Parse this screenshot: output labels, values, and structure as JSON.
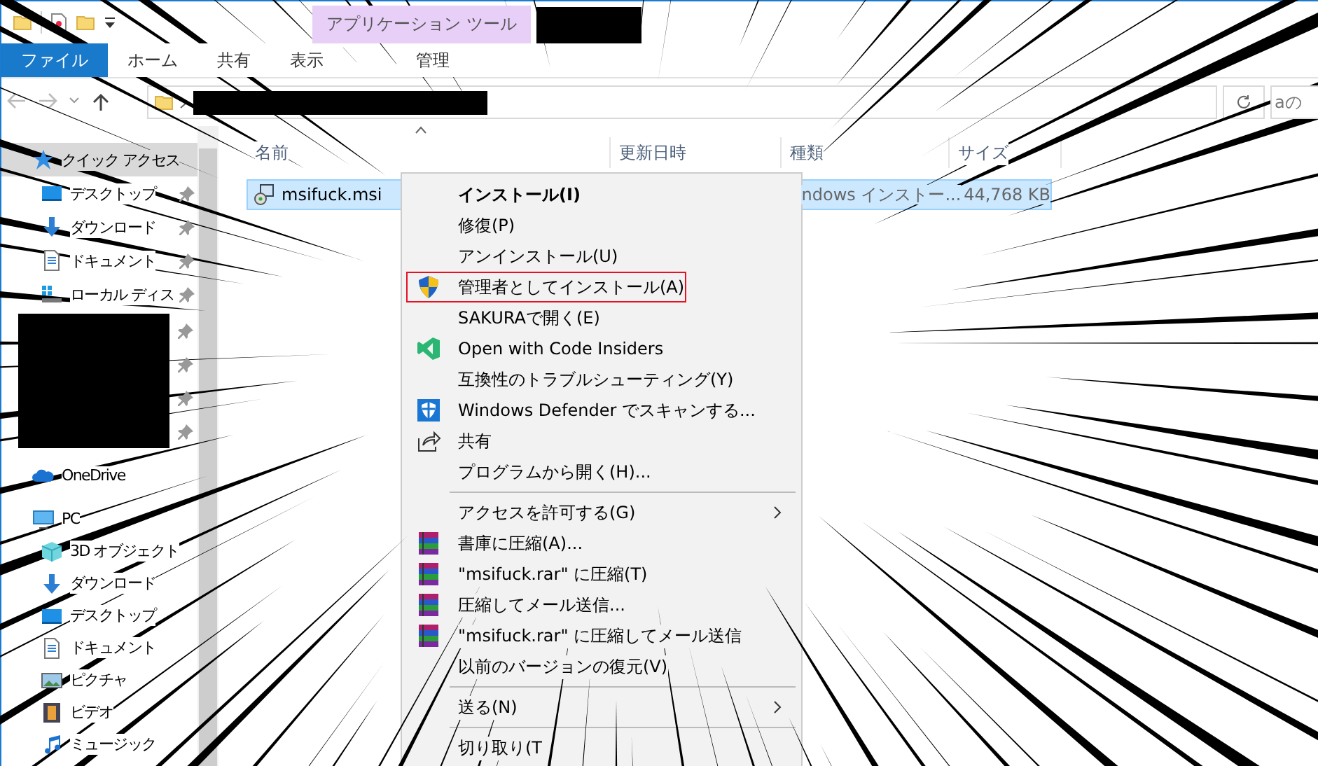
{
  "title_bar": {
    "contextual_tab": "アプリケーション ツール"
  },
  "ribbon_tabs": [
    {
      "label": "ファイル",
      "selected": true
    },
    {
      "label": "ホーム",
      "selected": false
    },
    {
      "label": "共有",
      "selected": false
    },
    {
      "label": "表示",
      "selected": false
    },
    {
      "label": "管理",
      "selected": false
    }
  ],
  "search": {
    "placeholder": "aの"
  },
  "sidebar": {
    "items": [
      {
        "label": "クイック アクセス",
        "kind": "star",
        "selected": true,
        "children": [
          {
            "label": "デスクトップ",
            "kind": "desktop",
            "pinned": true
          },
          {
            "label": "ダウンロード",
            "kind": "download",
            "pinned": true
          },
          {
            "label": "ドキュメント",
            "kind": "document",
            "pinned": true
          },
          {
            "label": "ローカル ディス",
            "kind": "drive",
            "pinned": true
          }
        ]
      },
      {
        "label": "OneDrive",
        "kind": "cloud",
        "selected": false
      },
      {
        "label": "PC",
        "kind": "pc",
        "selected": false,
        "children": [
          {
            "label": "3D オブジェクト",
            "kind": "cube",
            "pinned": false
          },
          {
            "label": "ダウンロード",
            "kind": "download",
            "pinned": false
          },
          {
            "label": "デスクトップ",
            "kind": "desktop",
            "pinned": false
          },
          {
            "label": "ドキュメント",
            "kind": "document",
            "pinned": false
          },
          {
            "label": "ピクチャ",
            "kind": "picture",
            "pinned": false
          },
          {
            "label": "ビデオ",
            "kind": "video",
            "pinned": false
          },
          {
            "label": "ミュージック",
            "kind": "music",
            "pinned": false
          }
        ]
      }
    ]
  },
  "table": {
    "columns": [
      "名前",
      "更新日時",
      "種類",
      "サイズ"
    ],
    "rows": [
      {
        "name": "msifuck.msi",
        "type": "ndows インストー...",
        "size": "44,768 KB",
        "selected": true
      }
    ]
  },
  "context_menu": {
    "items": [
      {
        "kind": "command",
        "label": "インストール(I)",
        "bold": true
      },
      {
        "kind": "command",
        "label": "修復(P)"
      },
      {
        "kind": "command",
        "label": "アンインストール(U)"
      },
      {
        "kind": "shield-command",
        "label": "管理者としてインストール(A)",
        "outlined": true
      },
      {
        "kind": "command",
        "label": "SAKURAで開く(E)"
      },
      {
        "kind": "editor-command",
        "label": "Open with Code Insiders"
      },
      {
        "kind": "command",
        "label": "互換性のトラブルシューティング(Y)"
      },
      {
        "kind": "scanner-command",
        "label": "Windows Defender でスキャンする..."
      },
      {
        "kind": "share-command",
        "label": "共有"
      },
      {
        "kind": "command",
        "label": "プログラムから開く(H)..."
      },
      {
        "kind": "separator"
      },
      {
        "kind": "command",
        "label": "アクセスを許可する(G)",
        "submenu": true
      },
      {
        "kind": "archive-command",
        "label": "書庫に圧縮(A)..."
      },
      {
        "kind": "archive-command",
        "label": "\"msifuck.rar\" に圧縮(T)"
      },
      {
        "kind": "archive-command",
        "label": "圧縮してメール送信..."
      },
      {
        "kind": "archive-command",
        "label": "\"msifuck.rar\" に圧縮してメール送信"
      },
      {
        "kind": "command",
        "label": "以前のバージョンの復元(V)"
      },
      {
        "kind": "separator"
      },
      {
        "kind": "command",
        "label": "送る(N)",
        "submenu": true
      },
      {
        "kind": "separator"
      },
      {
        "kind": "command",
        "label": "切り取り(T"
      }
    ]
  }
}
